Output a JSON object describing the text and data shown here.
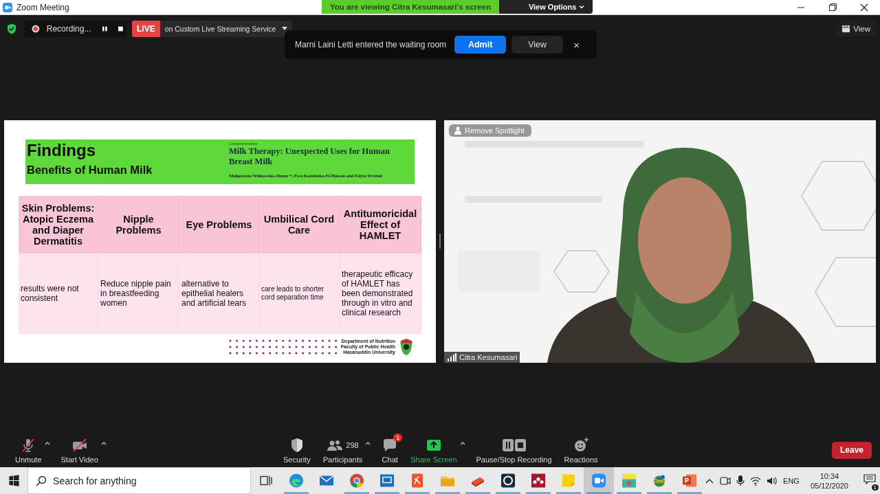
{
  "window": {
    "title": "Zoom Meeting"
  },
  "share_banner": {
    "text": "You are viewing Citra Kesumasari's screen",
    "options": "View Options"
  },
  "recording": {
    "label": "Recording..."
  },
  "live": {
    "badge": "LIVE",
    "service": "on Custom Live Streaming Service"
  },
  "view_button": "View",
  "notification": {
    "text": "Marni Laini Letti entered the waiting room",
    "admit": "Admit",
    "view": "View",
    "close": "×"
  },
  "shared_slide": {
    "title": "Findings",
    "subtitle": "Benefits of Human Milk",
    "article": {
      "category": "Communication",
      "title": "Milk Therapy: Unexpected Uses for Human Breast Milk",
      "authors": "Malgorzata Witkowska-Zimny *, Ewa Kamińska-El-Hassan and Edyta Wróbel"
    },
    "table": {
      "columns": [
        "Skin Problems: Atopic Eczema and Diaper Dermatitis",
        "Nipple Problems",
        "Eye Problems",
        "Umbilical Cord Care",
        "Antitumoricidal Effect of HAMLET"
      ],
      "rows": [
        [
          "results were not consistent",
          "Reduce nipple pain in breastfeeding women",
          "alternative to epithelial healers and artificial tears",
          "care leads to shorter cord separation time",
          "therapeutic efficacy of HAMLET has been demonstrated through in vitro and clinical research"
        ]
      ]
    },
    "footer": [
      "Department of Nutrition",
      "Faculty of Public Health",
      "Hasanuddin University"
    ]
  },
  "video_tile": {
    "kind": "picture",
    "spotlight_button": "Remove Spotlight",
    "participant": "Citra Kesumasari"
  },
  "toolbar": {
    "left": [
      {
        "kind": "mic",
        "label": "Unmute",
        "caret": true
      },
      {
        "kind": "video",
        "label": "Start Video",
        "caret": true
      }
    ],
    "center": [
      {
        "kind": "security",
        "label": "Security",
        "caret": false
      },
      {
        "kind": "participants",
        "label": "Participants",
        "count": "298",
        "caret": true
      },
      {
        "kind": "chat",
        "label": "Chat",
        "badge": "1",
        "caret": false
      },
      {
        "kind": "share",
        "label": "Share Screen",
        "caret": true
      },
      {
        "kind": "record",
        "label": "Pause/Stop Recording",
        "caret": false
      },
      {
        "kind": "reactions",
        "label": "Reactions",
        "caret": false
      }
    ],
    "leave": "Leave"
  },
  "taskbar": {
    "search_placeholder": "Search for anything",
    "apps": [
      {
        "kind": "taskview",
        "running": false,
        "selected": false
      },
      {
        "kind": "edge",
        "running": true,
        "selected": false
      },
      {
        "kind": "mail",
        "running": false,
        "selected": false
      },
      {
        "kind": "chrome",
        "running": true,
        "selected": false
      },
      {
        "kind": "remote",
        "running": true,
        "selected": false
      },
      {
        "kind": "pdf",
        "running": true,
        "selected": false
      },
      {
        "kind": "folder",
        "running": true,
        "selected": false
      },
      {
        "kind": "book",
        "running": true,
        "selected": false
      },
      {
        "kind": "camera",
        "running": true,
        "selected": false
      },
      {
        "kind": "mendeley",
        "running": true,
        "selected": false
      },
      {
        "kind": "notes",
        "running": true,
        "selected": false
      },
      {
        "kind": "zoom",
        "running": true,
        "selected": true
      },
      {
        "kind": "game",
        "running": true,
        "selected": false
      },
      {
        "kind": "globe",
        "running": true,
        "selected": false
      },
      {
        "kind": "powerpoint",
        "running": true,
        "selected": false
      }
    ],
    "language": "ENG",
    "time": "10:34",
    "date": "05/12/2020",
    "notification_count": "1"
  }
}
